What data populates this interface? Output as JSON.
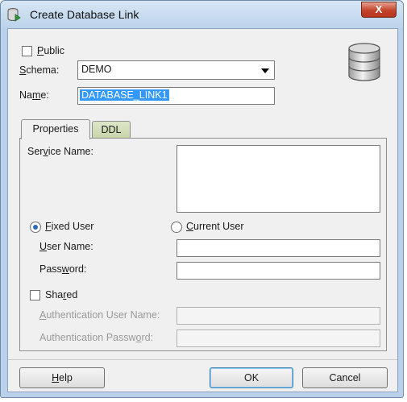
{
  "window": {
    "title": "Create Database Link",
    "close_glyph": "X"
  },
  "icons": {
    "app": "database-link-icon",
    "database": "database-icon"
  },
  "form": {
    "public": {
      "pre": "",
      "key": "P",
      "post": "ublic",
      "checked": false
    },
    "schema": {
      "pre": "",
      "key": "S",
      "post": "chema:",
      "value": "DEMO"
    },
    "name": {
      "pre": "Na",
      "key": "m",
      "post": "e:",
      "value": "DATABASE_LINK1"
    }
  },
  "tabs": [
    {
      "label": "Properties",
      "active": true
    },
    {
      "label": "DDL",
      "active": false
    }
  ],
  "properties": {
    "service_name": {
      "pre": "Ser",
      "key": "v",
      "post": "ice Name:"
    },
    "fixed_user": {
      "pre": "",
      "key": "F",
      "post": "ixed User",
      "selected": true
    },
    "current_user": {
      "pre": "",
      "key": "C",
      "post": "urrent User",
      "selected": false
    },
    "user_name": {
      "pre": "",
      "key": "U",
      "post": "ser Name:"
    },
    "password": {
      "pre": "Pass",
      "key": "w",
      "post": "ord:"
    },
    "shared": {
      "pre": "Sha",
      "key": "r",
      "post": "ed",
      "checked": false
    },
    "auth_user_name": {
      "pre": "",
      "key": "A",
      "post": "uthentication User Name:"
    },
    "auth_password": {
      "pre": "Authentication Passw",
      "key": "o",
      "post": "rd:"
    }
  },
  "buttons": {
    "help": {
      "pre": "",
      "key": "H",
      "post": "elp"
    },
    "ok": "OK",
    "cancel": "Cancel"
  },
  "colors": {
    "selection": "#3399ff",
    "close_button": "#c2432a",
    "inactive_tab": "#c7d4a9"
  }
}
